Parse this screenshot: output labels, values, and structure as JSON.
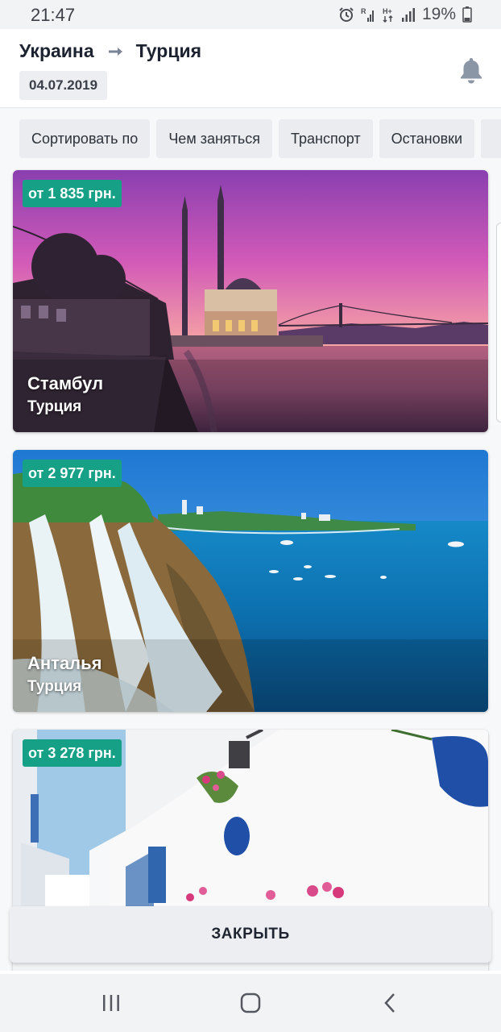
{
  "status_bar": {
    "time": "21:47",
    "battery": "19%",
    "icons": [
      "alarm-icon",
      "signal-r-icon",
      "network-h-icon",
      "signal-icon",
      "battery-icon"
    ]
  },
  "header": {
    "from": "Украина",
    "to": "Турция",
    "date": "04.07.2019",
    "bell_icon": "bell-icon"
  },
  "filters": [
    "Сортировать по",
    "Чем заняться",
    "Транспорт",
    "Остановки"
  ],
  "destinations": [
    {
      "price": "от 1 835 грн.",
      "city": "Стамбул",
      "country": "Турция"
    },
    {
      "price": "от 2 977 грн.",
      "city": "Анталья",
      "country": "Турция"
    },
    {
      "price": "от 3 278 грн.",
      "city": "",
      "country": ""
    }
  ],
  "close_button": "ЗАКРЫТЬ",
  "colors": {
    "price_badge": "#16a085",
    "chip_background": "#eceef1"
  }
}
